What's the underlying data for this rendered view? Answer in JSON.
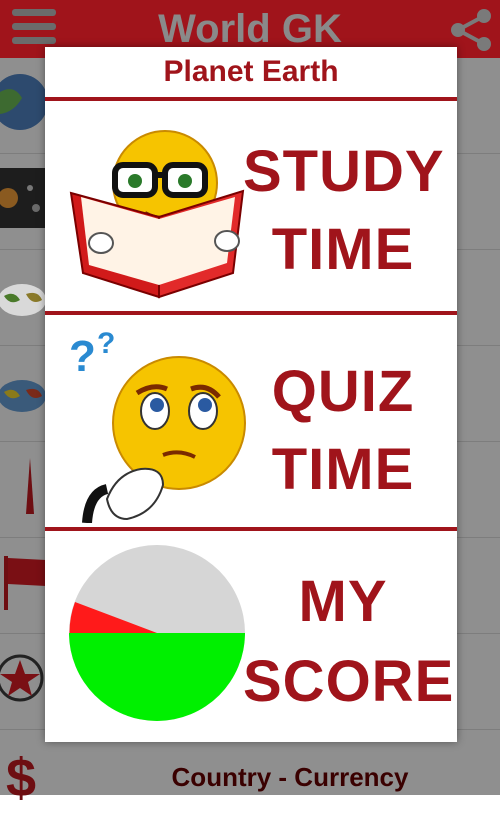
{
  "app": {
    "title": "World GK",
    "menu_icon": "hamburger-icon",
    "share_icon": "share-icon",
    "bar_color": "#a0141b"
  },
  "background_list": {
    "visible_label": "Country - Currency"
  },
  "dialog": {
    "title": "Planet Earth",
    "options": [
      {
        "line1": "STUDY",
        "line2": "TIME",
        "icon": "reading-smiley-icon"
      },
      {
        "line1": "QUIZ",
        "line2": "TIME",
        "icon": "thinking-smiley-icon"
      },
      {
        "line1": "MY",
        "line2": "SCORE",
        "icon": "score-pie-icon"
      }
    ],
    "accent_color": "#a0141b"
  }
}
